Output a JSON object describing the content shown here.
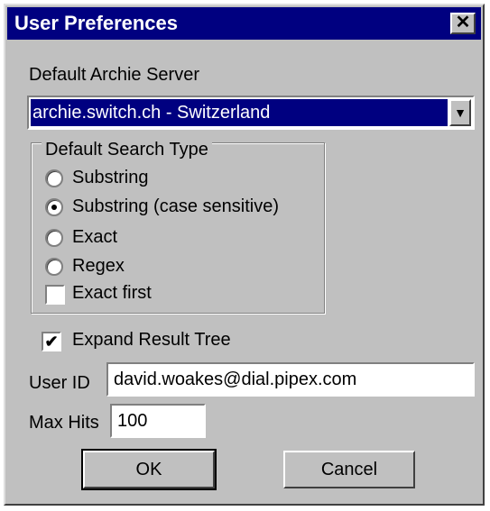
{
  "window": {
    "title": "User Preferences",
    "close_glyph": "✕"
  },
  "server": {
    "label": "Default Archie Server",
    "selected": "archie.switch.ch - Switzerland",
    "arrow_glyph": "▼"
  },
  "search_type": {
    "group_label": "Default Search Type",
    "options": [
      {
        "label": "Substring",
        "selected": false
      },
      {
        "label": "Substring (case sensitive)",
        "selected": true
      },
      {
        "label": "Exact",
        "selected": false
      },
      {
        "label": "Regex",
        "selected": false
      }
    ],
    "exact_first": {
      "label": "Exact first",
      "checked": false
    }
  },
  "expand_tree": {
    "label": "Expand Result Tree",
    "checked": true,
    "check_glyph": "✔"
  },
  "user_id": {
    "label": "User ID",
    "value": "david.woakes@dial.pipex.com"
  },
  "max_hits": {
    "label": "Max Hits",
    "value": "100"
  },
  "buttons": {
    "ok": "OK",
    "cancel": "Cancel"
  }
}
